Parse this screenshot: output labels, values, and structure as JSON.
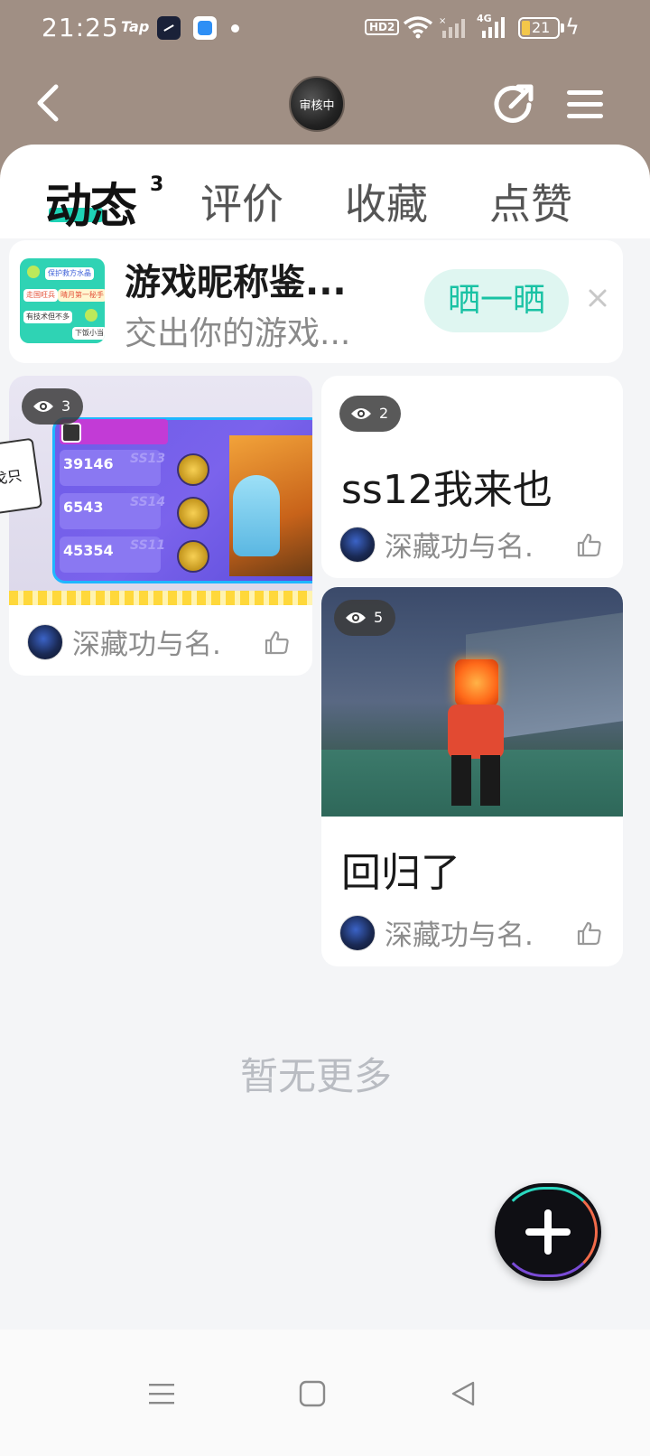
{
  "status_bar": {
    "time": "21:25",
    "tap_label": "Tap",
    "hd_label": "HD2",
    "network_label": "4G",
    "battery_level": "21",
    "icons": [
      "clock-app-icon",
      "blue-app-icon",
      "dot-icon",
      "wifi-icon",
      "signal-icon",
      "battery-icon",
      "charging-icon"
    ]
  },
  "header": {
    "avatar_status": "审核中",
    "icons": [
      "back-icon",
      "share-icon",
      "menu-icon"
    ]
  },
  "tabs": [
    {
      "label": "动态",
      "count": "3",
      "active": true
    },
    {
      "label": "评价",
      "active": false
    },
    {
      "label": "收藏",
      "active": false
    },
    {
      "label": "点赞",
      "active": false
    }
  ],
  "colors": {
    "header_bg": "#a08f84",
    "accent": "#1ed3b6",
    "button_text": "#19c2a4",
    "button_bg": "#dff6f1"
  },
  "promo": {
    "title": "游戏昵称鉴...",
    "subtitle": "交出你的游戏...",
    "button_label": "晒一晒",
    "thumb_chips": [
      "保护救方水晶",
      "走国旺兵",
      "晴月第一秘手",
      "有技术但不多",
      "下饭小当"
    ]
  },
  "posts": [
    {
      "views": "3",
      "author": "深藏功与名.",
      "image_scores": [
        "39146",
        "6543",
        "45354"
      ],
      "image_seasons": [
        "SS13",
        "SS14",
        "SS11"
      ],
      "image_side_text": "戈只"
    },
    {
      "views": "2",
      "title": "ss12我来也",
      "author": "深藏功与名."
    },
    {
      "views": "5",
      "title": "回归了",
      "author": "深藏功与名."
    }
  ],
  "footer": {
    "no_more_text": "暂无更多"
  },
  "system_nav": [
    "recents-button",
    "home-button",
    "back-button"
  ]
}
